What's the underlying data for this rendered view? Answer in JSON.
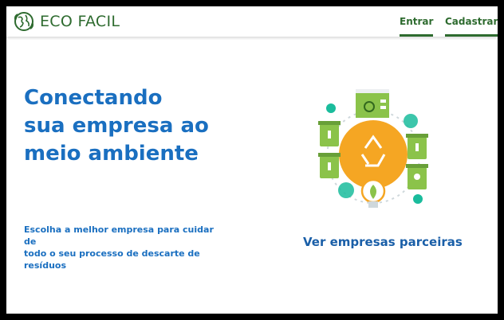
{
  "header": {
    "brand": "ECO FACIL",
    "nav": {
      "login": "Entrar",
      "signup": "Cadastrar"
    }
  },
  "hero": {
    "title_lines": [
      "Conectando",
      "sua empresa ao",
      "meio ambiente"
    ],
    "subtitle_lines": [
      "Escolha a melhor  empresa para cuidar de",
      "todo o seu processo de descarte de",
      "resíduos"
    ],
    "cta": "Ver empresas parceiras"
  },
  "colors": {
    "brand_green": "#2e6b2f",
    "hero_blue": "#1a6fc0",
    "illustration_orange": "#f5a623",
    "bin_green": "#8bc34a",
    "accent_teal": "#1abc9c"
  },
  "icons": [
    "globe-leaf-icon",
    "factory-icon",
    "recycle-icon",
    "waste-bin-icon",
    "lightbulb-leaf-icon"
  ]
}
